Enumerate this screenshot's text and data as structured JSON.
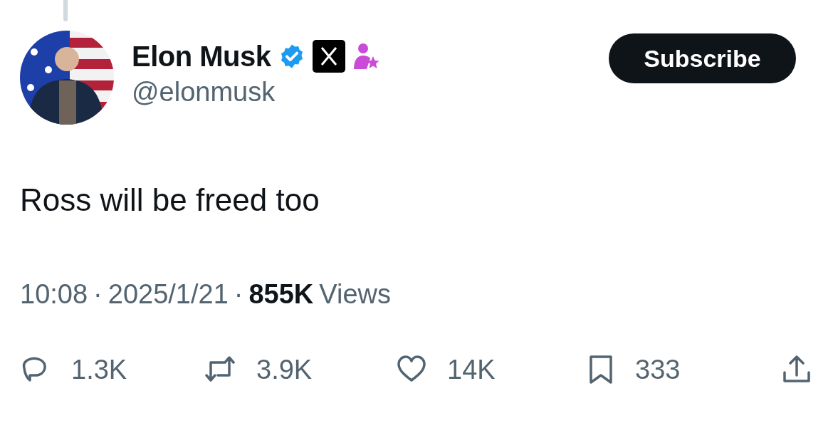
{
  "author": {
    "name": "Elon Musk",
    "handle": "@elonmusk",
    "verified": true
  },
  "subscribe_button": "Subscribe",
  "text": "Ross will be freed too",
  "meta": {
    "time": "10:08",
    "separator": "·",
    "date": "2025/1/21",
    "separator_2": "·",
    "views_count": "855K",
    "views_label": "Views"
  },
  "actions": [
    {
      "kind": "reply",
      "count": "1.3K"
    },
    {
      "kind": "repost",
      "count": "3.9K"
    },
    {
      "kind": "like",
      "count": "14K"
    },
    {
      "kind": "bookmark",
      "count": "333"
    },
    {
      "kind": "share"
    }
  ]
}
